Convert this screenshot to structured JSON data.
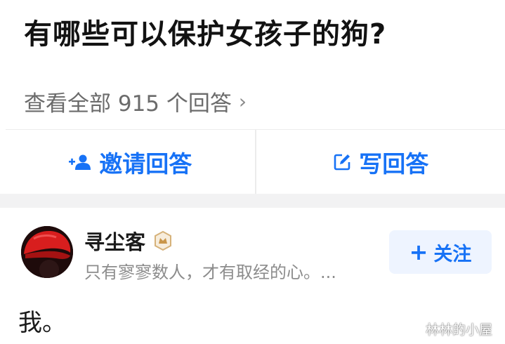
{
  "question": {
    "title": "有哪些可以保护女孩子的狗?"
  },
  "answers_link": {
    "label": "查看全部 915 个回答",
    "chevron": "›"
  },
  "actions": {
    "invite": {
      "label": "邀请回答",
      "icon": "invite-person-icon"
    },
    "write": {
      "label": "写回答",
      "icon": "edit-icon"
    }
  },
  "author": {
    "name": "寻尘客",
    "bio": "只有寥寥数人，才有取经的心。...",
    "badge_icon": "certified-badge-icon"
  },
  "follow": {
    "plus": "+",
    "label": "关注"
  },
  "answer": {
    "text": "我。"
  },
  "watermark": {
    "text": "林林的小屋"
  },
  "colors": {
    "accent": "#1772f6",
    "follow_bg": "#eef4ff",
    "band": "#f2f2f3",
    "muted": "#8c8c8c"
  }
}
